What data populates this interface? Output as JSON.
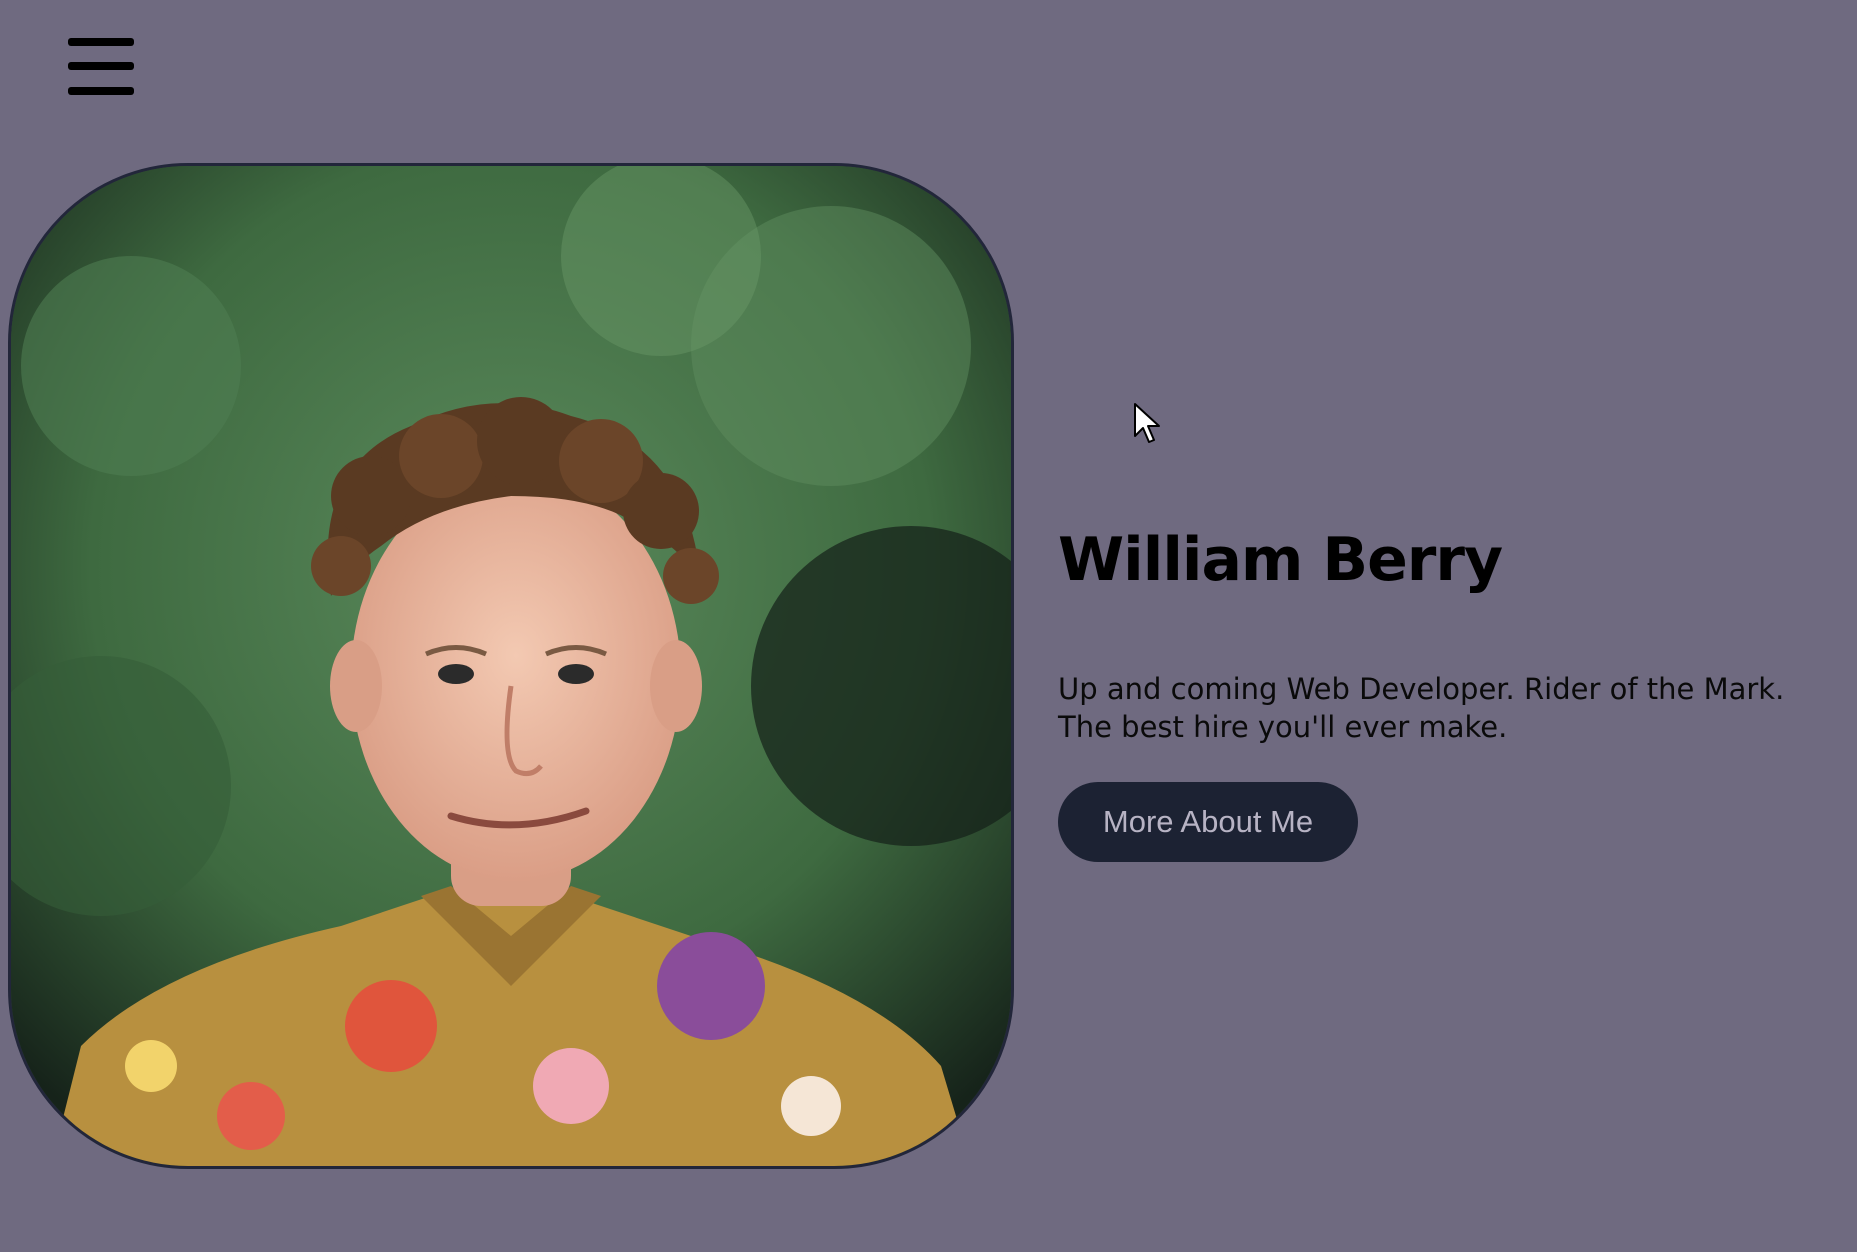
{
  "nav": {
    "menu_icon": "hamburger-menu-icon"
  },
  "hero": {
    "name": "William Berry",
    "tagline_line1": "Up and coming Web Developer. Rider of the Mark.",
    "tagline_line2": "The best hire you'll ever make.",
    "cta_label": "More About Me",
    "portrait_icon": "profile-photo"
  },
  "colors": {
    "background": "#6f6a80",
    "button_bg": "#1c2233",
    "button_text": "#b7b3c4",
    "text": "#000000"
  }
}
